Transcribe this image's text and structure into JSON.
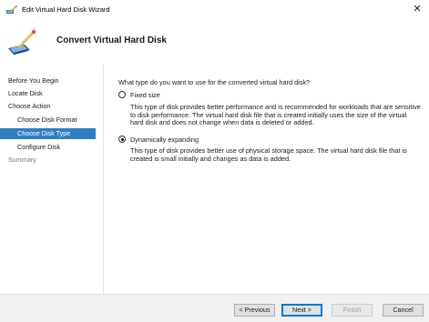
{
  "window": {
    "title": "Edit Virtual Hard Disk Wizard",
    "close_label": "✕"
  },
  "header": {
    "title": "Convert Virtual Hard Disk"
  },
  "nav": {
    "items": [
      {
        "label": "Before You Begin",
        "state": "normal"
      },
      {
        "label": "Locate Disk",
        "state": "normal"
      },
      {
        "label": "Choose Action",
        "state": "normal"
      },
      {
        "label": "Choose Disk Format",
        "state": "normal"
      },
      {
        "label": "Choose Disk Type",
        "state": "selected"
      },
      {
        "label": "Configure Disk",
        "state": "normal"
      },
      {
        "label": "Summary",
        "state": "disabled"
      }
    ]
  },
  "content": {
    "question": "What type do you want to use for the converted virtual hard disk?",
    "options": [
      {
        "label": "Fixed size",
        "checked": false,
        "description_lines": [
          "This type of disk provides better performance and is recommended for workloads that are sensitive",
          "to disk performance. The virtual hard disk file that is created initially uses the size of the virtual",
          "hard disk and does not change when data is deleted or added."
        ]
      },
      {
        "label": "Dynamically expanding",
        "checked": true,
        "description_lines": [
          "This type of disk provides better use of physical storage space. The virtual hard disk file that is",
          "created is small initially and changes as data is added."
        ]
      }
    ]
  },
  "buttons": {
    "previous": "< Previous",
    "next": "Next >",
    "finish": "Finish",
    "cancel": "Cancel"
  },
  "icons": {
    "title": "wizard-disk-icon",
    "header": "disk-wand-icon"
  }
}
